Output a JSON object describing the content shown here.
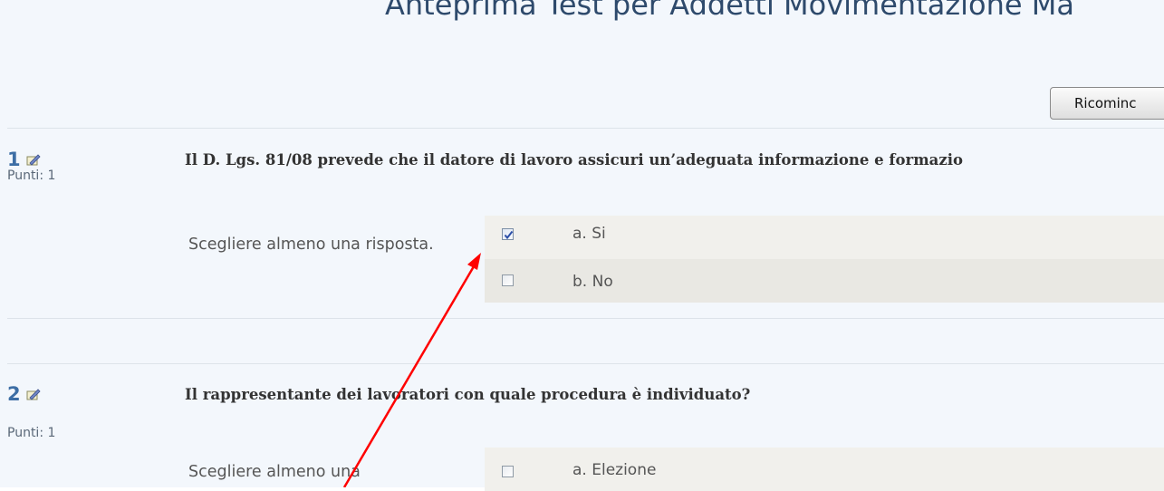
{
  "page": {
    "title": "Anteprima Test per Addetti Movimentazione Ma"
  },
  "toolbar": {
    "restart_label": "Ricominc"
  },
  "questions": [
    {
      "number": "1",
      "points": "Punti: 1",
      "text": "Il D. Lgs. 81/08 prevede che il datore di lavoro assicuri un’adeguata informazione e formazio",
      "prompt": "Scegliere almeno una risposta.",
      "answers": [
        {
          "label": "a. Si",
          "checked": true
        },
        {
          "label": "b. No",
          "checked": false
        }
      ]
    },
    {
      "number": "2",
      "points": "Punti: 1",
      "text": "Il rappresentante dei lavoratori con quale procedura è individuato?",
      "prompt": "Scegliere almeno una",
      "answers": [
        {
          "label": "a. Elezione",
          "checked": false
        }
      ]
    }
  ],
  "annotation": {
    "arrow_color": "#ff0000"
  }
}
